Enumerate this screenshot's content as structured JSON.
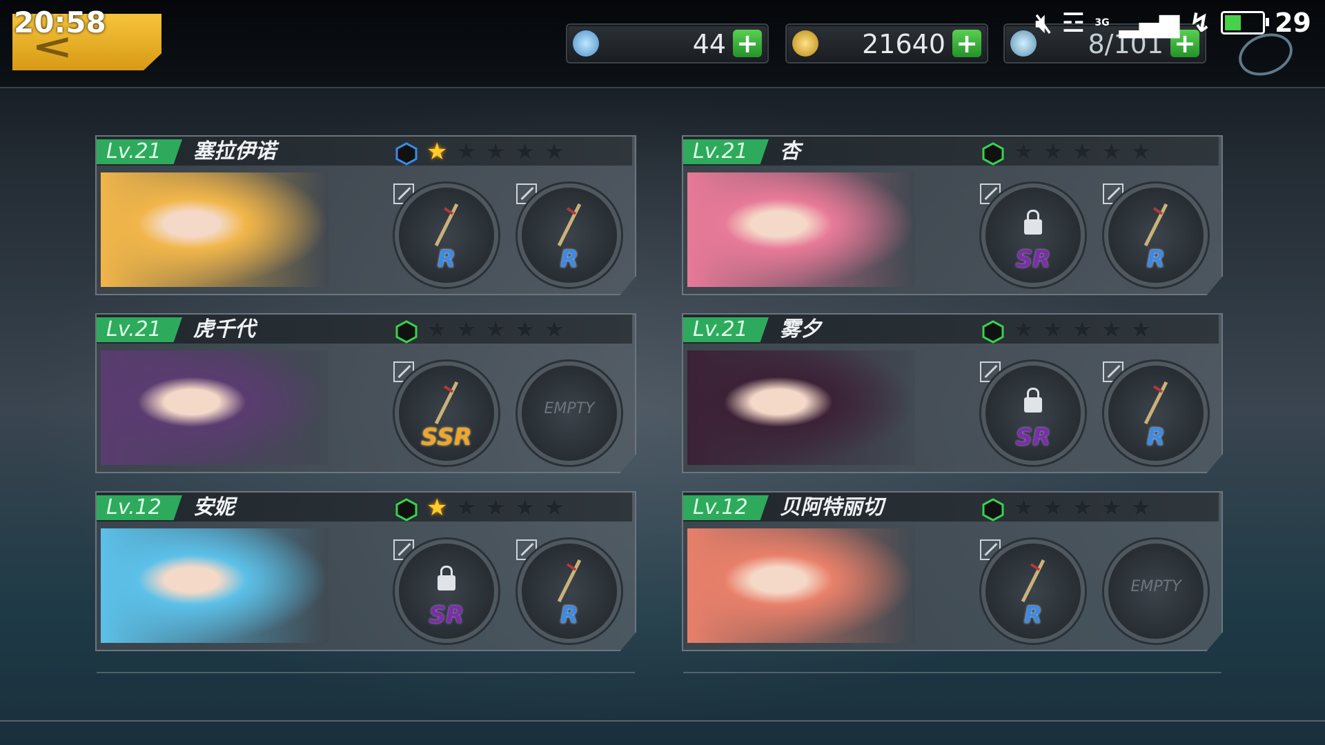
{
  "status_bar": {
    "time": "20:58",
    "network": "3G",
    "battery_level": "29"
  },
  "resources": {
    "gems": "44",
    "gold": "21640",
    "stamina": "8/101"
  },
  "characters": [
    {
      "level": "Lv.21",
      "name": "塞拉伊诺",
      "rank_color": "#3a8be8",
      "stars_filled": 1,
      "stars_total": 5,
      "slots": [
        {
          "rarity": "R",
          "label": "R",
          "locked": false,
          "empty": false
        },
        {
          "rarity": "R",
          "label": "R",
          "locked": false,
          "empty": false
        }
      ]
    },
    {
      "level": "Lv.21",
      "name": "杏",
      "rank_color": "#37d34c",
      "stars_filled": 0,
      "stars_total": 5,
      "slots": [
        {
          "rarity": "SR",
          "label": "SR",
          "locked": true,
          "empty": false
        },
        {
          "rarity": "R",
          "label": "R",
          "locked": false,
          "empty": false
        }
      ]
    },
    {
      "level": "Lv.21",
      "name": "虎千代",
      "rank_color": "#37d34c",
      "stars_filled": 0,
      "stars_total": 5,
      "slots": [
        {
          "rarity": "SSR",
          "label": "SSR",
          "locked": false,
          "empty": false
        },
        {
          "rarity": "",
          "label": "EMPTY",
          "locked": false,
          "empty": true
        }
      ]
    },
    {
      "level": "Lv.21",
      "name": "雾夕",
      "rank_color": "#37d34c",
      "stars_filled": 0,
      "stars_total": 5,
      "slots": [
        {
          "rarity": "SR",
          "label": "SR",
          "locked": true,
          "empty": false
        },
        {
          "rarity": "R",
          "label": "R",
          "locked": false,
          "empty": false
        }
      ]
    },
    {
      "level": "Lv.12",
      "name": "安妮",
      "rank_color": "#37d34c",
      "stars_filled": 1,
      "stars_total": 5,
      "slots": [
        {
          "rarity": "SR",
          "label": "SR",
          "locked": true,
          "empty": false
        },
        {
          "rarity": "R",
          "label": "R",
          "locked": false,
          "empty": false
        }
      ]
    },
    {
      "level": "Lv.12",
      "name": "贝阿特丽切",
      "rank_color": "#37d34c",
      "stars_filled": 0,
      "stars_total": 5,
      "slots": [
        {
          "rarity": "R",
          "label": "R",
          "locked": false,
          "empty": false
        },
        {
          "rarity": "",
          "label": "EMPTY",
          "locked": false,
          "empty": true
        }
      ]
    }
  ],
  "portrait_colors": [
    "#f1b64a",
    "#e77a98",
    "#5a3c70",
    "#3c2236",
    "#5cc0e8",
    "#e8806a"
  ]
}
